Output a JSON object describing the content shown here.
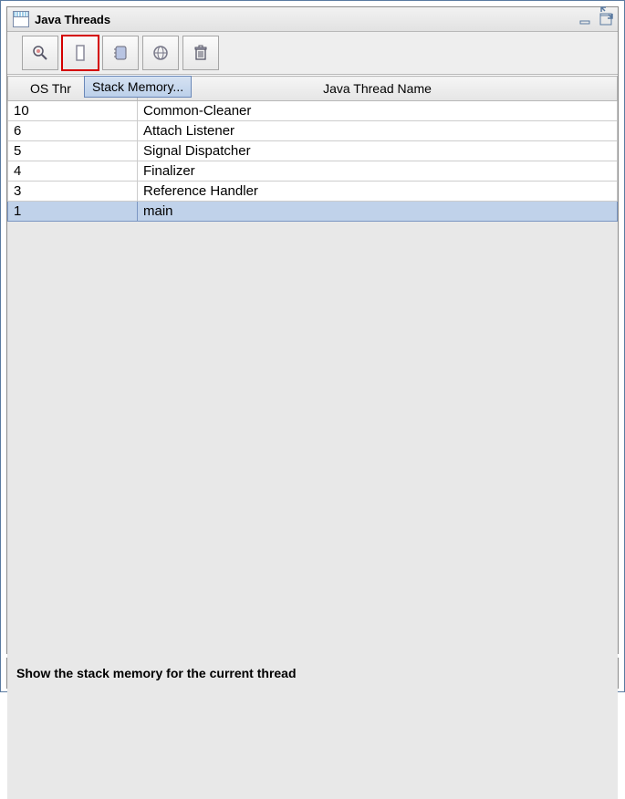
{
  "header": {
    "title": "Java Threads"
  },
  "toolbar": {
    "tooltip": "Stack Memory..."
  },
  "table": {
    "headers": {
      "col0": "OS Thr",
      "col1": "Java Thread Name"
    },
    "rows": [
      {
        "id": "10",
        "name": "Common-Cleaner"
      },
      {
        "id": "6",
        "name": "Attach Listener"
      },
      {
        "id": "5",
        "name": "Signal Dispatcher"
      },
      {
        "id": "4",
        "name": "Finalizer"
      },
      {
        "id": "3",
        "name": "Reference Handler"
      },
      {
        "id": "1",
        "name": "main"
      }
    ],
    "selected_index": 5
  },
  "statusbar": {
    "text": "Show the stack memory for the current thread"
  }
}
